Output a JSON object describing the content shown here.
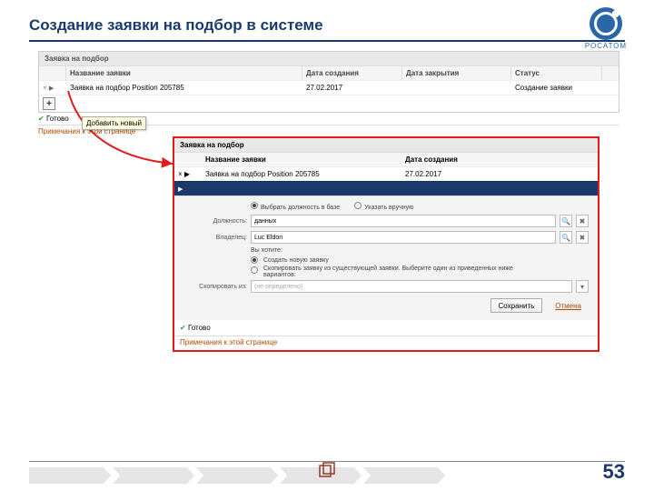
{
  "slide": {
    "title": "Создание заявки на подбор в системе",
    "page_number": "53",
    "logo_text": "РОСАТОМ"
  },
  "shot1": {
    "header": "Заявка на подбор",
    "cols": {
      "name": "Название заявки",
      "created": "Дата создания",
      "closed": "Дата закрытия",
      "status": "Статус"
    },
    "row": {
      "name": "Заявка на подбор Position 205785",
      "created": "27.02.2017",
      "closed": "",
      "status": "Создание заявки"
    },
    "add_tooltip": "Добавить новый",
    "ready": "Готово",
    "notes": "Примечания к этой странице"
  },
  "shot2": {
    "header": "Заявка на подбор",
    "cols": {
      "name": "Название заявки",
      "created": "Дата создания"
    },
    "row": {
      "name": "Заявка на подбор Position 205785",
      "created": "27.02.2017"
    },
    "form": {
      "radio_db": "Выбрать должность в базе",
      "radio_manual": "Указать вручную",
      "position_label": "Должность:",
      "position_value": "данных",
      "owner_label": "Владелец:",
      "owner_value": "Luc Eldon",
      "you_want": "Вы хотите:",
      "opt_create": "Создать новую заявку",
      "opt_copy": "Скопировать заявку из существующей заявки. Выберите один из приведенных ниже вариантов:",
      "copy_from_label": "Скопировать из:",
      "copy_from_value": "(не определено)",
      "save": "Сохранить",
      "cancel": "Отмена"
    },
    "ready": "Готово",
    "notes": "Примечания к этой странице"
  }
}
